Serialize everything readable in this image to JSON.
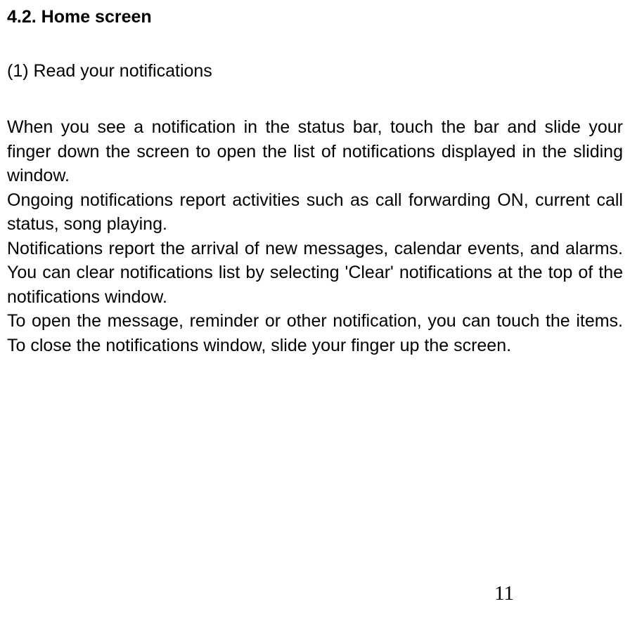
{
  "heading": "4.2. Home screen",
  "subheading": "(1) Read your notifications",
  "paragraph1": "When you see a notification in the status bar, touch the bar and slide your finger down the screen to open the list of notifications displayed in the sliding window.",
  "paragraph2": "Ongoing notifications report activities such as call forwarding ON, current call status, song playing.",
  "paragraph3": "Notifications report the arrival of new messages, calendar events, and alarms. You can clear notifications list by selecting 'Clear' notifications at the top of the notifications window.",
  "paragraph4": "To open the message, reminder or other notification, you can touch the items. To close the notifications window, slide your finger up the screen.",
  "pageNumber": "11"
}
